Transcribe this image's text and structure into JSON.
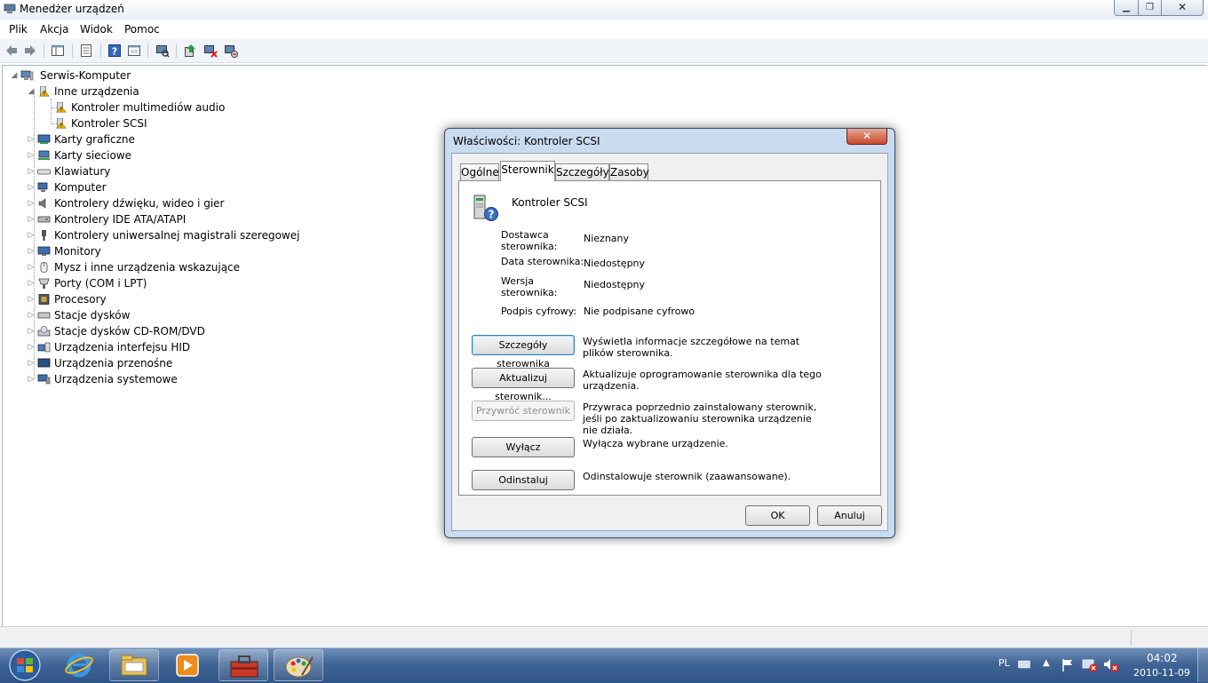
{
  "window": {
    "title": "Menedżer urządzeń",
    "controls": {
      "minimize": "▁",
      "maximize": "❐",
      "close": "✕"
    }
  },
  "menu": [
    "Plik",
    "Akcja",
    "Widok",
    "Pomoc"
  ],
  "toolbar": {
    "icons": [
      "back-arrow-icon",
      "forward-arrow-icon",
      "show-hide-console-tree-icon",
      "properties-icon",
      "help-icon",
      "view-icon",
      "scan-hardware-icon",
      "update-driver-icon",
      "disable-device-icon",
      "uninstall-device-icon"
    ]
  },
  "tree": {
    "root": "Serwis-Komputer",
    "other_devices": {
      "label": "Inne urządzenia",
      "children": [
        "Kontroler multimediów audio",
        "Kontroler SCSI"
      ]
    },
    "categories": [
      "Karty graficzne",
      "Karty sieciowe",
      "Klawiatury",
      "Komputer",
      "Kontrolery dźwięku, wideo i gier",
      "Kontrolery IDE ATA/ATAPI",
      "Kontrolery uniwersalnej magistrali szeregowej",
      "Monitory",
      "Mysz i inne urządzenia wskazujące",
      "Porty (COM i LPT)",
      "Procesory",
      "Stacje dysków",
      "Stacje dysków CD-ROM/DVD",
      "Urządzenia interfejsu HID",
      "Urządzenia przenośne",
      "Urządzenia systemowe"
    ]
  },
  "dialog": {
    "title": "Właściwości: Kontroler SCSI",
    "close": "✕",
    "tabs": [
      "Ogólne",
      "Sterownik",
      "Szczegóły",
      "Zasoby"
    ],
    "active_tab": "Sterownik",
    "device_name": "Kontroler SCSI",
    "fields": [
      {
        "label": "Dostawca\nsterownika:",
        "value": "Nieznany"
      },
      {
        "label": "Data sterownika:",
        "value": "Niedostępny"
      },
      {
        "label": "Wersja\nsterownika:",
        "value": "Niedostępny"
      },
      {
        "label": "Podpis cyfrowy:",
        "value": "Nie podpisane cyfrowo"
      }
    ],
    "actions": [
      {
        "button": "Szczegóły sterownika",
        "desc": "Wyświetla informacje szczegółowe na temat\nplików sterownika.",
        "enabled": true
      },
      {
        "button": "Aktualizuj sterownik...",
        "desc": "Aktualizuje oprogramowanie sterownika dla tego\nurządzenia.",
        "enabled": true
      },
      {
        "button": "Przywróć sterownik",
        "desc": "Przywraca poprzednio zainstalowany sterownik,\njeśli po zaktualizowaniu sterownika urządzenie\nnie działa.",
        "enabled": false
      },
      {
        "button": "Wyłącz",
        "desc": "Wyłącza wybrane urządzenie.",
        "enabled": true
      },
      {
        "button": "Odinstaluj",
        "desc": "Odinstalowuje sterownik (zaawansowane).",
        "enabled": true
      }
    ],
    "ok": "OK",
    "cancel": "Anuluj"
  },
  "taskbar": {
    "pinned": [
      "windows-explorer-icon",
      "media-player-icon",
      "toolbox-app-icon",
      "paint-app-icon"
    ],
    "language": "PL",
    "time": "04:02",
    "date": "2010-11-09"
  },
  "colors": {
    "taskbar": "#3f6495",
    "dialog_frame": "#c9dbee",
    "close_red": "#c74a2f",
    "warning": "#f2c200"
  }
}
